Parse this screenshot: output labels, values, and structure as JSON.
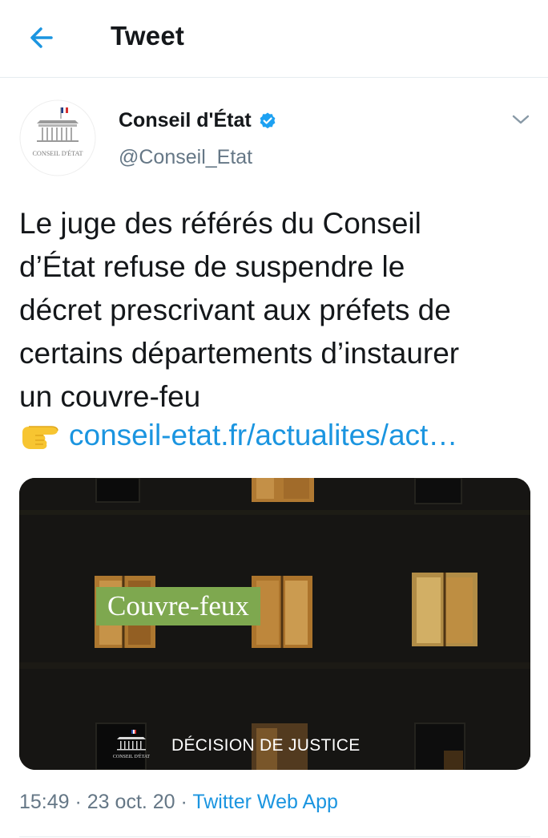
{
  "header": {
    "title": "Tweet",
    "back_icon": "arrow-left-icon"
  },
  "account": {
    "display_name": "Conseil d'État",
    "handle": "@Conseil_Etat",
    "verified_icon": "verified-badge-icon",
    "avatar_text": "CONSEIL D'ÉTAT"
  },
  "tweet": {
    "lines": [
      "Le juge des référés du Conseil",
      "d’État refuse de suspendre le",
      "décret prescrivant aux préfets de",
      "certains départements d’instaurer",
      "un couvre-feu"
    ],
    "link_emoji": "backhand-index-pointing-right-icon",
    "link_text": "conseil-etat.fr/actualites/act…"
  },
  "media": {
    "title": "Couvre-feux",
    "logo_text": "CONSEIL D'ÉTAT",
    "caption": "DÉCISION DE JUSTICE"
  },
  "meta": {
    "time": "15:49",
    "sep1": " · ",
    "date": "23 oct. 20",
    "sep2": " · ",
    "source": "Twitter Web App"
  },
  "colors": {
    "accent": "#1b95e0",
    "muted": "#657786",
    "text": "#14171a",
    "verified": "#1da1f2",
    "media_label": "#7ea84f"
  }
}
